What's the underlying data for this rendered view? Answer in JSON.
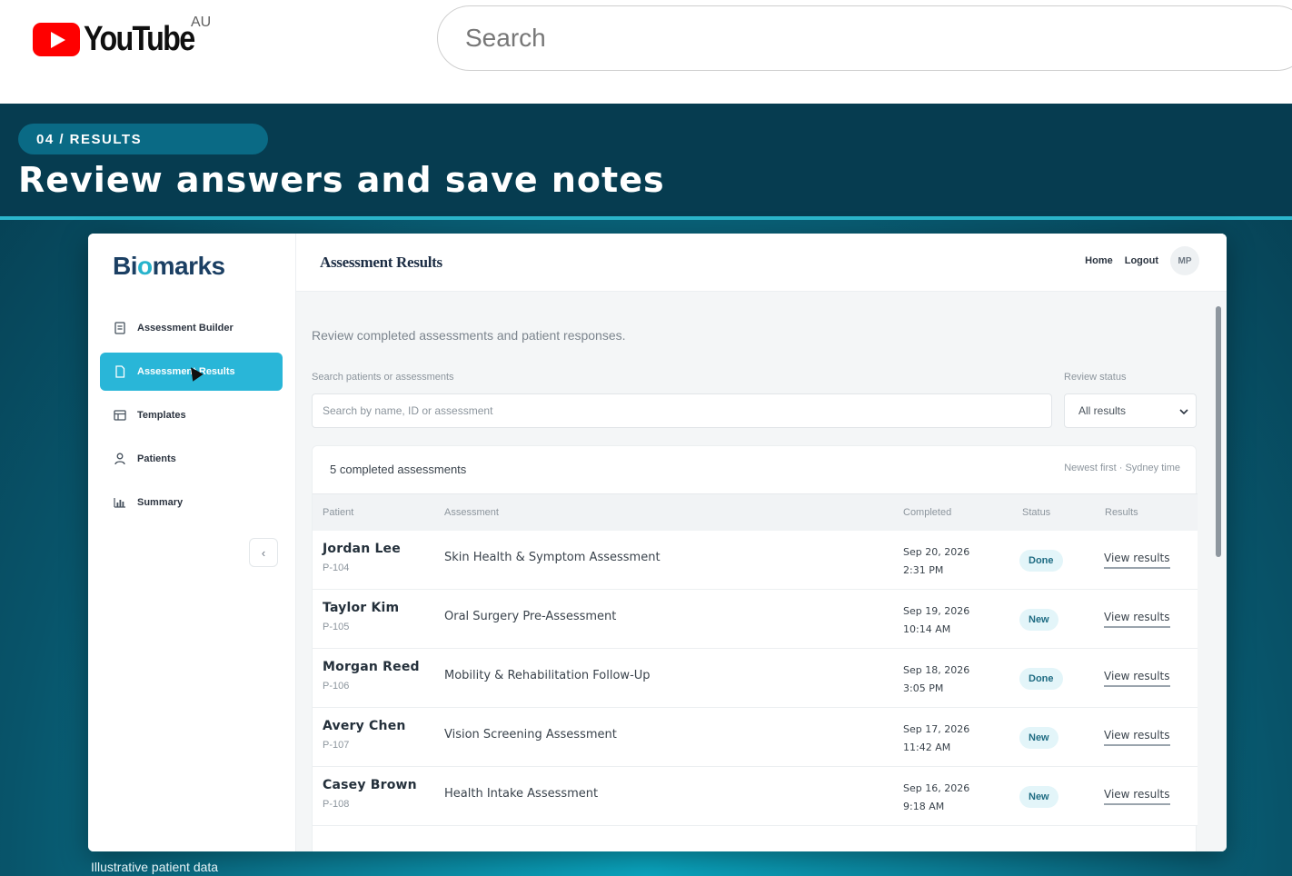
{
  "youtube": {
    "logo_text": "YouTube",
    "country": "AU",
    "search_placeholder": "Search"
  },
  "slide": {
    "chip": "04  /  RESULTS",
    "title": "Review answers and save notes",
    "caption": "Illustrative patient data"
  },
  "app": {
    "brand": {
      "part1": "Bi",
      "part2": "marks"
    },
    "sidebar": {
      "items": [
        {
          "label": "Assessment Builder",
          "icon": "document-icon"
        },
        {
          "label": "Assessment Results",
          "icon": "file-icon",
          "active": true
        },
        {
          "label": "Templates",
          "icon": "template-icon"
        },
        {
          "label": "Patients",
          "icon": "person-icon"
        },
        {
          "label": "Summary",
          "icon": "bar-chart-icon"
        }
      ],
      "collapse_glyph": "‹"
    },
    "topbar": {
      "title": "Assessment Results",
      "home": "Home",
      "logout": "Logout",
      "avatar": "MP"
    },
    "subtitle": "Review completed assessments and patient responses.",
    "search": {
      "label": "Search patients or assessments",
      "placeholder": "Search by name, ID or assessment"
    },
    "filter": {
      "label": "Review status",
      "value": "All results"
    },
    "table": {
      "count": "5 completed assessments",
      "sort": "Newest first · Sydney time",
      "headers": [
        "Patient",
        "Assessment",
        "Completed",
        "Status",
        "Results"
      ],
      "rows": [
        {
          "name": "Jordan Lee",
          "id": "P-104",
          "assessment": "Skin Health & Symptom Assessment",
          "date": "Sep 20, 2026",
          "time": "2:31 PM",
          "status": "Done",
          "action": "View results"
        },
        {
          "name": "Taylor Kim",
          "id": "P-105",
          "assessment": "Oral Surgery Pre-Assessment",
          "date": "Sep 19, 2026",
          "time": "10:14 AM",
          "status": "New",
          "action": "View results"
        },
        {
          "name": "Morgan Reed",
          "id": "P-106",
          "assessment": "Mobility & Rehabilitation Follow-Up",
          "date": "Sep 18, 2026",
          "time": "3:05 PM",
          "status": "Done",
          "action": "View results"
        },
        {
          "name": "Avery Chen",
          "id": "P-107",
          "assessment": "Vision Screening Assessment",
          "date": "Sep 17, 2026",
          "time": "11:42 AM",
          "status": "New",
          "action": "View results"
        },
        {
          "name": "Casey Brown",
          "id": "P-108",
          "assessment": "Health Intake Assessment",
          "date": "Sep 16, 2026",
          "time": "9:18 AM",
          "status": "New",
          "action": "View results"
        }
      ]
    }
  }
}
